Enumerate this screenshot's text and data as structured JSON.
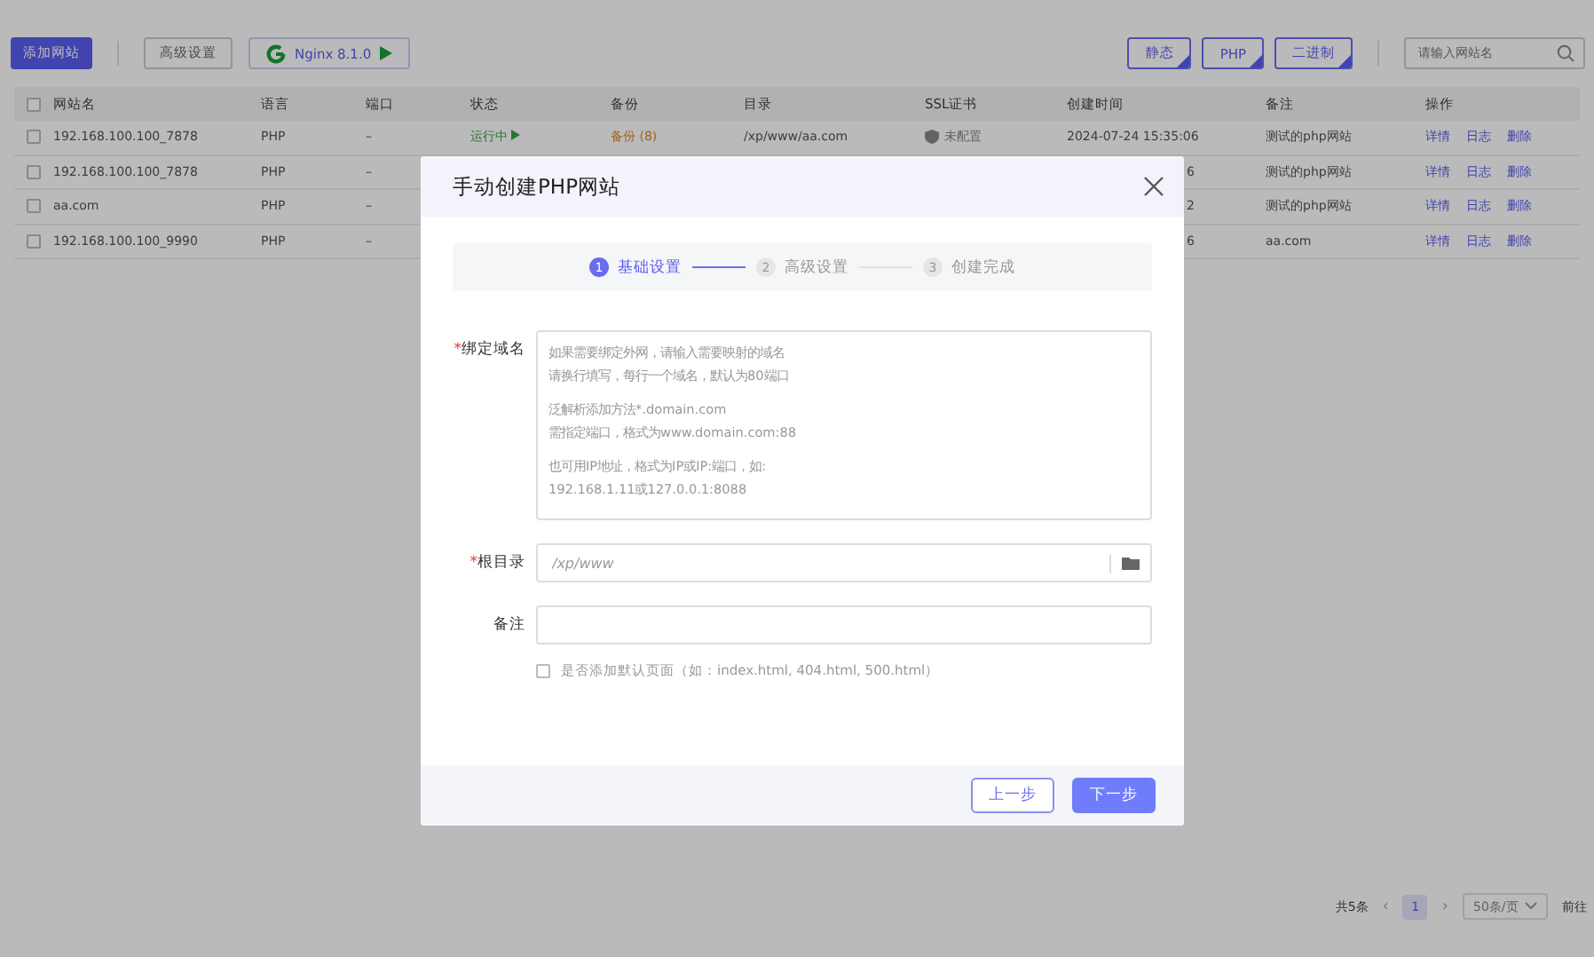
{
  "toolbar": {
    "add_button": "添加网站",
    "advanced_button": "高级设置",
    "server_button": "Nginx 8.1.0",
    "filters": [
      {
        "label": "静态"
      },
      {
        "label": "PHP"
      },
      {
        "label": "二进制"
      }
    ],
    "search": {
      "placeholder": "请输入网站名"
    }
  },
  "table": {
    "select_all_checked": false,
    "columns": [
      "网站名",
      "语言",
      "端口",
      "状态",
      "备份",
      "目录",
      "SSL证书",
      "创建时间",
      "备注",
      "操作"
    ],
    "rows": [
      {
        "checked": false,
        "name": "192.168.100.100_7878",
        "language": "PHP",
        "port": "–",
        "status": "运行中",
        "backup": "备份 (8)",
        "directory": "/xp/www/aa.com",
        "ssl": "未配置",
        "created": "2024-07-24 15:35:06",
        "clipped": false,
        "remark": "测试的php网站",
        "actions": [
          "详情",
          "日志",
          "删除"
        ]
      },
      {
        "checked": false,
        "name": "192.168.100.100_7878",
        "language": "PHP",
        "port": "–",
        "created": "6",
        "clipped": true,
        "remark": "测试的php网站",
        "actions": [
          "详情",
          "日志",
          "删除"
        ]
      },
      {
        "checked": false,
        "name": "aa.com",
        "language": "PHP",
        "port": "–",
        "created": "2",
        "clipped": true,
        "remark": "测试的php网站",
        "actions": [
          "详情",
          "日志",
          "删除"
        ]
      },
      {
        "checked": false,
        "name": "192.168.100.100_9990",
        "language": "PHP",
        "port": "–",
        "created": "6",
        "clipped": true,
        "remark": "aa.com",
        "actions": [
          "详情",
          "日志",
          "删除"
        ]
      }
    ]
  },
  "pagination": {
    "total": "共5条",
    "prev": "‹",
    "pages": [
      {
        "label": "1",
        "selected": true
      }
    ],
    "next": "›",
    "page_size": "50条/页",
    "goto": "前往"
  },
  "dialog": {
    "title": "手动创建PHP网站",
    "steps": [
      {
        "number": "1",
        "label": "基础设置",
        "selected": true
      },
      {
        "number": "2",
        "label": "高级设置",
        "selected": false
      },
      {
        "number": "3",
        "label": "创建完成",
        "selected": false
      }
    ],
    "fields": [
      {
        "kind": "textarea",
        "required_mark": "*",
        "label": "绑定域名",
        "placeholder": [
          [
            "如果需要绑定外网，请输入需要映射的域名",
            "请换行填写，每行一个域名，默认为80端口"
          ],
          [
            "泛解析添加方法*.domain.com",
            "需指定端口，格式为www.domain.com:88"
          ],
          [
            "也可用IP地址，格式为IP或IP:端口，如:",
            "192.168.1.11或127.0.0.1:8088"
          ]
        ]
      },
      {
        "kind": "folder",
        "required_mark": "*",
        "label": "根目录",
        "placeholder": "/xp/www"
      },
      {
        "kind": "text",
        "label": "备注"
      }
    ],
    "default_pages": {
      "checked": false,
      "label": "是否添加默认页面（如：index.html, 404.html, 500.html）"
    },
    "prev_button": "上一步",
    "next_button": "下一步"
  }
}
